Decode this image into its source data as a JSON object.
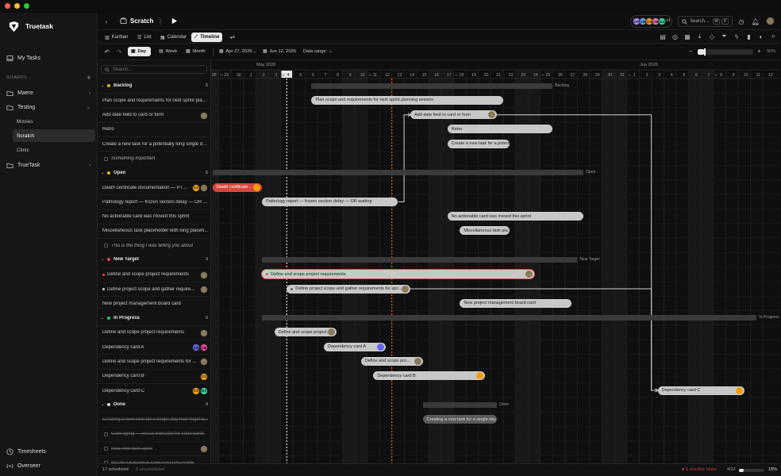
{
  "app": {
    "name": "Truetask"
  },
  "sidebar": {
    "my_tasks": "My Tasks",
    "boards_heading": "BOARDS",
    "boards": [
      {
        "label": "Maere",
        "expanded": false
      },
      {
        "label": "Testing",
        "expanded": true,
        "children": [
          "Movies",
          "Scratch",
          "Clinic"
        ],
        "active_child": "Scratch"
      },
      {
        "label": "TrueTask",
        "expanded": false
      }
    ],
    "bottom": [
      "Timesheets",
      "Overseer"
    ]
  },
  "topbar": {
    "title": "Scratch",
    "search_placeholder": "Search...",
    "shortcut_cmd": "⌘",
    "shortcut_key": "K",
    "avatars": [
      {
        "initials": "CP",
        "color": "#a78bfa"
      },
      {
        "initials": "CR",
        "color": "#60a5fa"
      },
      {
        "initials": "CS",
        "color": "#f59e0b"
      },
      {
        "initials": "CB",
        "color": "#f472b6"
      },
      {
        "initials": "DJ",
        "color": "#34d399"
      }
    ],
    "avatar_more": "+1"
  },
  "views": {
    "tabs": [
      "Kanban",
      "List",
      "Calendar",
      "Timeline"
    ],
    "active": "Timeline"
  },
  "controls": {
    "zoom_options": [
      "Day",
      "Week",
      "Month"
    ],
    "active_zoom": "Day",
    "start_date": "Apr 27, 2026",
    "end_date": "Jun 12, 2026",
    "arrow": "→",
    "range_label": "Data range",
    "zoom_minus": "−",
    "zoom_plus": "+",
    "zoom_level": 0.12,
    "zoom_percent": "96%"
  },
  "list": {
    "search_placeholder": "Search...",
    "groups": [
      {
        "name": "Backlog",
        "color": "#eab308",
        "count": "5",
        "items": [
          {
            "title": "Plan scope and requirements for next sprint plan..."
          },
          {
            "title": "Add date field to card or form",
            "avatars": [
              {
                "initials": "",
                "color": "#8a7a5a"
              }
            ]
          },
          {
            "title": "Retro"
          },
          {
            "title": "Create a new task for a potentially long single da..."
          },
          {
            "title": "Something important",
            "style": "italic",
            "checkbox": true
          }
        ]
      },
      {
        "name": "Open",
        "color": "#eab308",
        "count": "5",
        "items": [
          {
            "title": "Death certificate documentation — PT-...",
            "avatars": [
              {
                "initials": "CS",
                "color": "#f59e0b"
              },
              {
                "initials": "",
                "color": "#8a7a5a"
              }
            ]
          },
          {
            "title": "Pathology report — frozen section delay — OR w..."
          },
          {
            "title": "No actionable card was moved this sprint"
          },
          {
            "title": "Miscellaneous task placeholder with long placeh..."
          },
          {
            "title": "This is the thing I was telling you about",
            "style": "italic",
            "checkbox": true
          }
        ]
      },
      {
        "name": "New Target",
        "color": "#ef4444",
        "count": "3",
        "items": [
          {
            "title": "Define and scope project requirements",
            "dot": "#ef4444",
            "avatars": [
              {
                "initials": "",
                "color": "#8a7a5a"
              }
            ]
          },
          {
            "title": "Define project scope and gather require...",
            "dot": "#d6d6d6",
            "avatars": [
              {
                "initials": "",
                "color": "#8a7a5a"
              }
            ]
          },
          {
            "title": "New project management board card"
          }
        ]
      },
      {
        "name": "In Progress",
        "color": "#22c55e",
        "count": "5",
        "items": [
          {
            "title": "Define and scope project requirements",
            "avatars": [
              {
                "initials": "",
                "color": "#8a7a5a"
              }
            ]
          },
          {
            "title": "Dependency card A",
            "avatars": [
              {
                "initials": "CR",
                "color": "#6366f1"
              },
              {
                "initials": "CB",
                "color": "#ec4899"
              }
            ]
          },
          {
            "title": "Define and scope project requirements for ...",
            "avatars": [
              {
                "initials": "",
                "color": "#8a7a5a"
              }
            ]
          },
          {
            "title": "Dependency card B",
            "avatars": [
              {
                "initials": "CS",
                "color": "#f59e0b"
              }
            ]
          },
          {
            "title": "Dependency card C",
            "avatars": [
              {
                "initials": "CS",
                "color": "#f59e0b"
              },
              {
                "initials": "DJ",
                "color": "#34d399"
              }
            ]
          }
        ]
      },
      {
        "name": "Done",
        "color": "#d6d6d6",
        "count": "4",
        "items": [
          {
            "title": "Creating a new task for a single day that might b...",
            "style": "done"
          },
          {
            "title": "Card aging — visual indicator for stale cards",
            "style": "done",
            "checkbox": true
          },
          {
            "title": "New new task open",
            "style": "done",
            "checkbox": true,
            "avatars": [
              {
                "initials": "",
                "color": "#8a7a5a"
              }
            ]
          },
          {
            "title": "NO ACTIONABLE CREATED IN DONE",
            "style": "done",
            "checkbox": true
          }
        ]
      }
    ]
  },
  "timeline": {
    "month_labels": [
      {
        "label": "2026",
        "day": -1
      },
      {
        "label": "May 2026",
        "day": 4
      },
      {
        "label": "Jun 2026",
        "day": 35
      }
    ],
    "days": [
      {
        "d": "28",
        "w": true
      },
      {
        "d": "29",
        "w": false,
        "wk": "W"
      },
      {
        "d": "30",
        "w": false
      },
      {
        "d": "1",
        "w": false
      },
      {
        "d": "2",
        "w": true
      },
      {
        "d": "3",
        "w": true
      },
      {
        "d": "4",
        "w": false,
        "wk": "W",
        "today": true
      },
      {
        "d": "5",
        "w": false
      },
      {
        "d": "6",
        "w": false
      },
      {
        "d": "7",
        "w": false
      },
      {
        "d": "8",
        "w": false
      },
      {
        "d": "9",
        "w": true
      },
      {
        "d": "10",
        "w": true
      },
      {
        "d": "11",
        "w": false,
        "wk": "W"
      },
      {
        "d": "12",
        "w": false
      },
      {
        "d": "13",
        "w": false
      },
      {
        "d": "14",
        "w": false
      },
      {
        "d": "15",
        "w": false
      },
      {
        "d": "16",
        "w": true
      },
      {
        "d": "17",
        "w": true
      },
      {
        "d": "18",
        "w": false,
        "wk": "W"
      },
      {
        "d": "19",
        "w": false
      },
      {
        "d": "20",
        "w": false
      },
      {
        "d": "21",
        "w": false
      },
      {
        "d": "22",
        "w": false
      },
      {
        "d": "23",
        "w": true
      },
      {
        "d": "24",
        "w": true
      },
      {
        "d": "25",
        "w": false,
        "wk": "W"
      },
      {
        "d": "26",
        "w": false
      },
      {
        "d": "27",
        "w": false
      },
      {
        "d": "28",
        "w": false
      },
      {
        "d": "29",
        "w": false
      },
      {
        "d": "30",
        "w": true
      },
      {
        "d": "31",
        "w": true
      },
      {
        "d": "1",
        "w": false,
        "wk": "W"
      },
      {
        "d": "2",
        "w": false
      },
      {
        "d": "3",
        "w": false
      },
      {
        "d": "4",
        "w": false
      },
      {
        "d": "5",
        "w": false
      },
      {
        "d": "6",
        "w": true
      },
      {
        "d": "7",
        "w": true
      },
      {
        "d": "8",
        "w": false,
        "wk": "W"
      },
      {
        "d": "9",
        "w": false
      },
      {
        "d": "10",
        "w": false
      },
      {
        "d": "11",
        "w": false
      },
      {
        "d": "12",
        "w": false
      }
    ],
    "today_index": 6,
    "dashed_index": 14.5,
    "group_bars": [
      {
        "row": 0,
        "start": 8.5,
        "end": 28,
        "label": "Backlog"
      },
      {
        "row": 6,
        "start": 0.5,
        "end": 30.5,
        "label": "Open"
      },
      {
        "row": 12,
        "start": 4.5,
        "end": 30,
        "label": "New Target"
      },
      {
        "row": 16,
        "start": 4.5,
        "end": 44.5,
        "label": "In Progress"
      },
      {
        "row": 22,
        "start": 17.5,
        "end": 23.5,
        "label": "Done"
      }
    ],
    "bars": [
      {
        "row": 1,
        "start": 8.5,
        "end": 24,
        "label": "Plan scope and requirements for next sprint planning session"
      },
      {
        "row": 2,
        "start": 16.5,
        "end": 23.5,
        "label": "Add date field to card or form",
        "avatars": [
          "#8a7a5a"
        ]
      },
      {
        "row": 3,
        "start": 19.5,
        "end": 28,
        "label": "Retro"
      },
      {
        "row": 4,
        "start": 19.5,
        "end": 24.5,
        "label": "Create a new task for a potenti..."
      },
      {
        "row": 7,
        "start": 0.5,
        "end": 4.5,
        "label": "Death certificate ...",
        "type": "red",
        "avatars": [
          "#f59e0b"
        ]
      },
      {
        "row": 8,
        "start": 4.5,
        "end": 15.5,
        "label": "Pathology report — frozen section delay — OR waiting"
      },
      {
        "row": 9,
        "start": 19.5,
        "end": 30.5,
        "label": "No actionable card was moved this sprint"
      },
      {
        "row": 10,
        "start": 20.5,
        "end": 24.5,
        "label": "Miscellaneous task pla..."
      },
      {
        "row": 13,
        "start": 4.5,
        "end": 26.5,
        "label": "Define and scope project requirements",
        "dot": "#ef4444",
        "outline": "#ef4444",
        "avatars": [
          "#8a7a5a"
        ]
      },
      {
        "row": 14,
        "start": 6.5,
        "end": 16.5,
        "label": "Define project scope and gather requirements for upc...",
        "dot": "#666",
        "avatars": [
          "#8a7a5a"
        ]
      },
      {
        "row": 15,
        "start": 20.5,
        "end": 29.5,
        "label": "New project management board card"
      },
      {
        "row": 17,
        "start": 5.5,
        "end": 10.5,
        "label": "Define and scope project...",
        "avatars": [
          "#8a7a5a"
        ]
      },
      {
        "row": 18,
        "start": 9.5,
        "end": 14.5,
        "label": "Dependency card A",
        "avatars": [
          "#6366f1"
        ]
      },
      {
        "row": 19,
        "start": 12.5,
        "end": 17.5,
        "label": "Define and scope pro...",
        "avatars": [
          "#8a7a5a"
        ]
      },
      {
        "row": 20,
        "start": 13.5,
        "end": 22.5,
        "label": "Dependency card B",
        "avatars": [
          "#f59e0b"
        ]
      },
      {
        "row": 21,
        "start": 36.5,
        "end": 43.5,
        "label": "Dependency card C",
        "avatars": [
          "#f59e0b"
        ]
      },
      {
        "row": 23,
        "start": 17.5,
        "end": 23.5,
        "label": "Creating a new task for a single day t...",
        "type": "dim"
      }
    ],
    "dependencies": [
      {
        "from_row": 8,
        "to_row": 2
      },
      {
        "from_row": 2,
        "to_row": 21
      },
      {
        "from_row": 14,
        "to_row": 21
      }
    ]
  },
  "footer": {
    "scheduled": "17 scheduled",
    "unscheduled": "6 unscheduled",
    "overdue_count": "1",
    "overdue_label": "overdue tasks",
    "progress_label": "4/22",
    "progress_fraction": 0.18,
    "progress_percent": "18%"
  },
  "colors": {
    "accent": "#e8e8e8",
    "today": "#ffffff",
    "dashed": "#f97316",
    "bar": "#c8c8c8"
  }
}
